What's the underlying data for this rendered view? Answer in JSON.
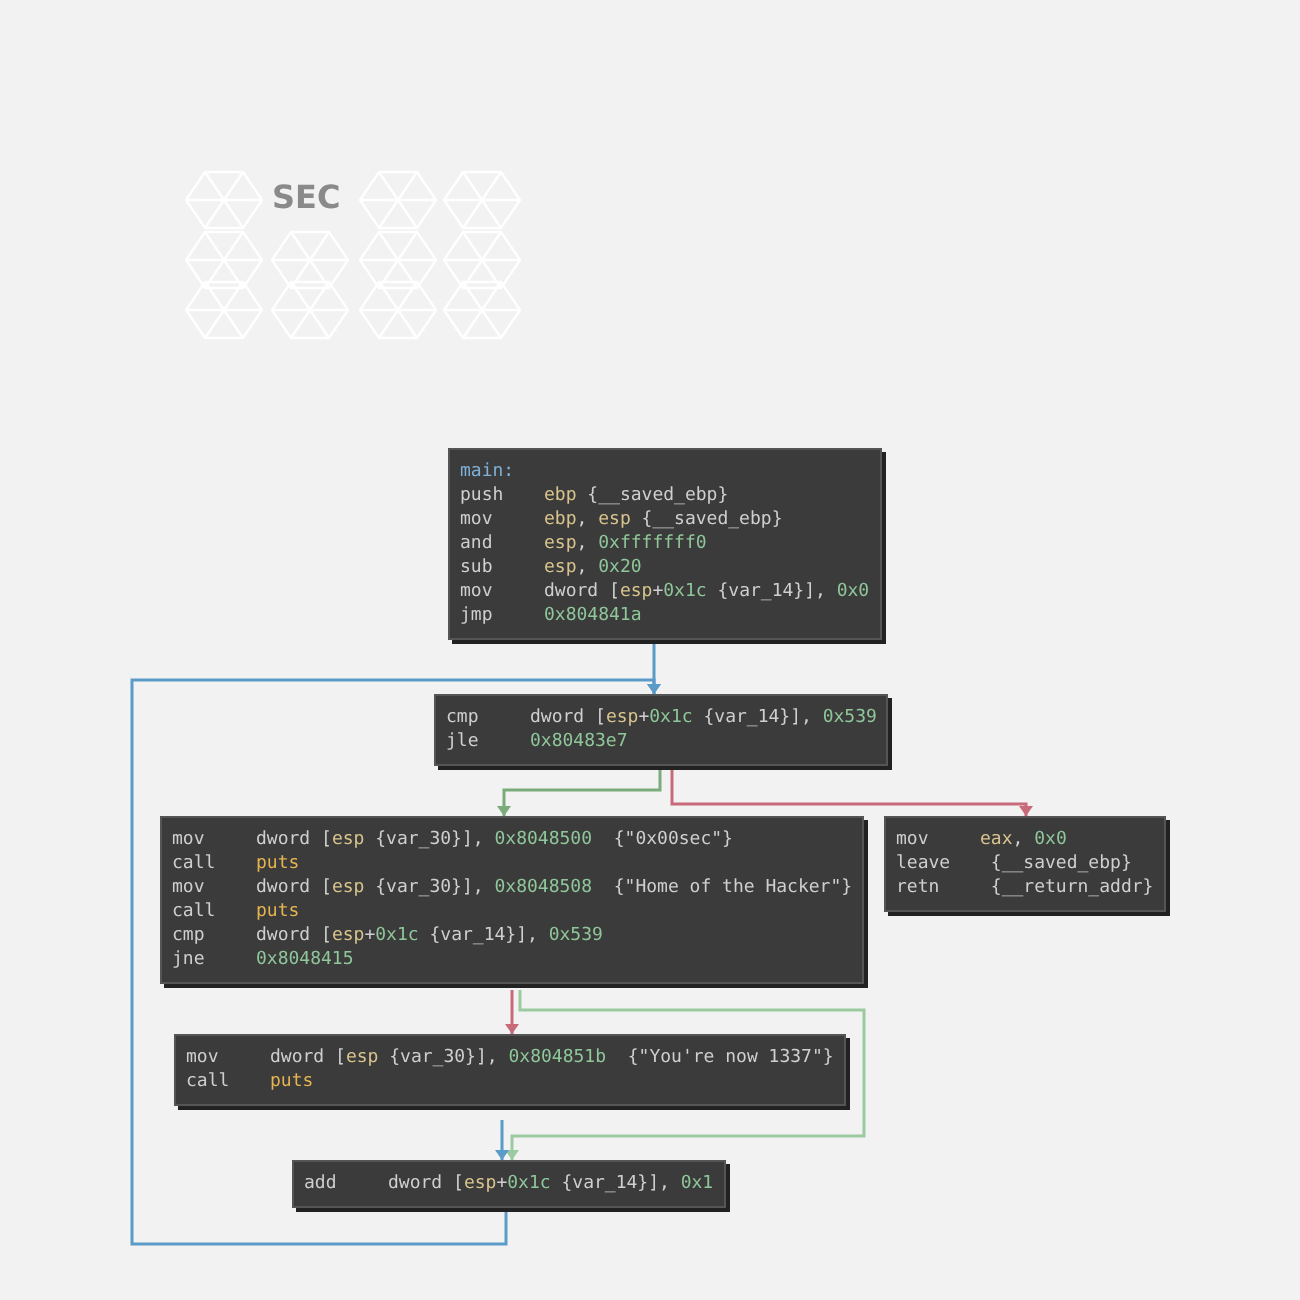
{
  "logo": {
    "text": "SEC"
  },
  "blocks": [
    {
      "label": "main:",
      "lines": [
        {
          "op": "push",
          "args": [
            {
              "kind": "reg",
              "text": "ebp"
            },
            {
              "kind": "plain",
              "text": " {__saved_ebp}"
            }
          ]
        },
        {
          "op": "mov",
          "args": [
            {
              "kind": "reg",
              "text": "ebp"
            },
            {
              "kind": "plain",
              "text": ", "
            },
            {
              "kind": "reg",
              "text": "esp"
            },
            {
              "kind": "plain",
              "text": " {__saved_ebp}"
            }
          ]
        },
        {
          "op": "and",
          "args": [
            {
              "kind": "reg",
              "text": "esp"
            },
            {
              "kind": "plain",
              "text": ", "
            },
            {
              "kind": "num",
              "text": "0xfffffff0"
            }
          ]
        },
        {
          "op": "sub",
          "args": [
            {
              "kind": "reg",
              "text": "esp"
            },
            {
              "kind": "plain",
              "text": ", "
            },
            {
              "kind": "num",
              "text": "0x20"
            }
          ]
        },
        {
          "op": "mov",
          "args": [
            {
              "kind": "plain",
              "text": "dword ["
            },
            {
              "kind": "reg",
              "text": "esp"
            },
            {
              "kind": "plain",
              "text": "+"
            },
            {
              "kind": "num",
              "text": "0x1c"
            },
            {
              "kind": "plain",
              "text": " {var_14}], "
            },
            {
              "kind": "num",
              "text": "0x0"
            }
          ]
        },
        {
          "op": "jmp",
          "args": [
            {
              "kind": "num",
              "text": "0x804841a"
            }
          ]
        }
      ]
    },
    {
      "lines": [
        {
          "op": "cmp",
          "args": [
            {
              "kind": "plain",
              "text": "dword ["
            },
            {
              "kind": "reg",
              "text": "esp"
            },
            {
              "kind": "plain",
              "text": "+"
            },
            {
              "kind": "num",
              "text": "0x1c"
            },
            {
              "kind": "plain",
              "text": " {var_14}], "
            },
            {
              "kind": "num",
              "text": "0x539"
            }
          ]
        },
        {
          "op": "jle",
          "args": [
            {
              "kind": "num",
              "text": "0x80483e7"
            }
          ]
        }
      ]
    },
    {
      "lines": [
        {
          "op": "mov",
          "args": [
            {
              "kind": "plain",
              "text": "dword ["
            },
            {
              "kind": "reg",
              "text": "esp"
            },
            {
              "kind": "plain",
              "text": " {var_30}], "
            },
            {
              "kind": "num",
              "text": "0x8048500"
            },
            {
              "kind": "plain",
              "text": "  {\"0x00sec\"}"
            }
          ]
        },
        {
          "op": "call",
          "args": [
            {
              "kind": "sym",
              "text": "puts"
            }
          ]
        },
        {
          "op": "mov",
          "args": [
            {
              "kind": "plain",
              "text": "dword ["
            },
            {
              "kind": "reg",
              "text": "esp"
            },
            {
              "kind": "plain",
              "text": " {var_30}], "
            },
            {
              "kind": "num",
              "text": "0x8048508"
            },
            {
              "kind": "plain",
              "text": "  {\"Home of the Hacker\"}"
            }
          ]
        },
        {
          "op": "call",
          "args": [
            {
              "kind": "sym",
              "text": "puts"
            }
          ]
        },
        {
          "op": "cmp",
          "args": [
            {
              "kind": "plain",
              "text": "dword ["
            },
            {
              "kind": "reg",
              "text": "esp"
            },
            {
              "kind": "plain",
              "text": "+"
            },
            {
              "kind": "num",
              "text": "0x1c"
            },
            {
              "kind": "plain",
              "text": " {var_14}], "
            },
            {
              "kind": "num",
              "text": "0x539"
            }
          ]
        },
        {
          "op": "jne",
          "args": [
            {
              "kind": "num",
              "text": "0x8048415"
            }
          ]
        }
      ]
    },
    {
      "lines": [
        {
          "op": "mov",
          "args": [
            {
              "kind": "reg",
              "text": "eax"
            },
            {
              "kind": "plain",
              "text": ", "
            },
            {
              "kind": "num",
              "text": "0x0"
            }
          ]
        },
        {
          "op": "leave",
          "args": [
            {
              "kind": "plain",
              "text": " {__saved_ebp}"
            }
          ]
        },
        {
          "op": "retn",
          "args": [
            {
              "kind": "plain",
              "text": " {__return_addr}"
            }
          ]
        }
      ]
    },
    {
      "lines": [
        {
          "op": "mov",
          "args": [
            {
              "kind": "plain",
              "text": "dword ["
            },
            {
              "kind": "reg",
              "text": "esp"
            },
            {
              "kind": "plain",
              "text": " {var_30}], "
            },
            {
              "kind": "num",
              "text": "0x804851b"
            },
            {
              "kind": "plain",
              "text": "  {\"You're now 1337\"}"
            }
          ]
        },
        {
          "op": "call",
          "args": [
            {
              "kind": "sym",
              "text": "puts"
            }
          ]
        }
      ]
    },
    {
      "lines": [
        {
          "op": "add",
          "args": [
            {
              "kind": "plain",
              "text": "dword ["
            },
            {
              "kind": "reg",
              "text": "esp"
            },
            {
              "kind": "plain",
              "text": "+"
            },
            {
              "kind": "num",
              "text": "0x1c"
            },
            {
              "kind": "plain",
              "text": " {var_14}], "
            },
            {
              "kind": "num",
              "text": "0x1"
            }
          ]
        }
      ]
    }
  ]
}
